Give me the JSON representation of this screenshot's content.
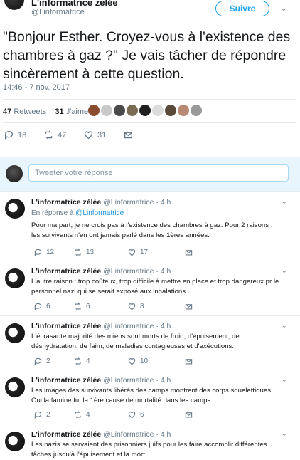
{
  "tweet": {
    "author_name": "L'informatrice zélée",
    "author_handle": "@Linformatrice",
    "follow_label": "Suivre",
    "text": "\"Bonjour Esther. Croyez-vous à l'existence des chambres à gaz ?\" Je vais tâcher de répondre sincèrement à cette question.",
    "timestamp": "14:46 - 7 nov. 2017",
    "retweets_count": "47",
    "retweets_label": "Retweets",
    "likes_count": "31",
    "likes_label": "J'aime",
    "actions": {
      "replies": "18",
      "retweets": "47",
      "likes": "31"
    }
  },
  "reply_box": {
    "placeholder": "Tweeter votre réponse"
  },
  "replies": [
    {
      "name": "L'informatrice zélée",
      "meta": "@Linformatrice · 4 h",
      "context_prefix": "En réponse à",
      "context_handle": "@Linformatrice",
      "text": "Pour ma part, je ne crois pas à l'existence des chambres à gaz. Pour 2 raisons : les survivants n'en ont jamais parlé dans les 1ères années.",
      "replies": "12",
      "retweets": "13",
      "likes": "17"
    },
    {
      "name": "L'informatrice zélée",
      "meta": "@Linformatrice · 4 h",
      "text": "L'autre raison : trop coûteux, trop difficile à mettre en place et trop dangereux pr le personnel nazi qui se serait exposé aux inhalations.",
      "replies": "6",
      "retweets": "6",
      "likes": "8"
    },
    {
      "name": "L'informatrice zélée",
      "meta": "@Linformatrice · 4 h",
      "text": "L'écrasante majorité des miens sont morts de froid, d'épuisement, de déshydratation, de faim, de maladies contagieuses et d'exécutions.",
      "replies": "2",
      "retweets": "4",
      "likes": "10"
    },
    {
      "name": "L'informatrice zélée",
      "meta": "@Linformatrice · 4 h",
      "text": "Les images des survivants libérés des camps montrent des corps squelettiques. Oui la famine fut la 1ère cause de mortalité dans les camps.",
      "replies": "2",
      "retweets": "4",
      "likes": "6"
    },
    {
      "name": "L'informatrice zélée",
      "meta": "@Linformatrice · 4 h",
      "text": "Les nazis se servaient des prisonniers juifs pour les faire accomplir différentes tâches jusqu'à l'épuisement et la mort."
    }
  ]
}
